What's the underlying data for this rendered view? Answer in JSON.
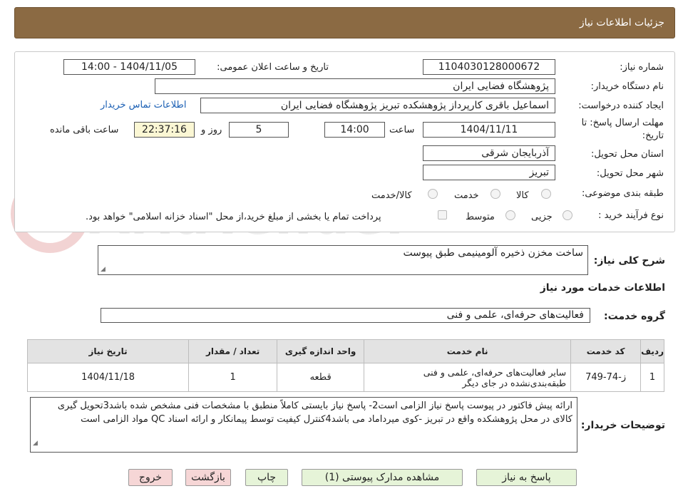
{
  "header": {
    "title": "جزئیات اطلاعات نیاز"
  },
  "watermark": {
    "text": "AriaTender.neT"
  },
  "fields": {
    "need_number_label": "شماره نیاز:",
    "need_number": "1104030128000672",
    "announce_label": "تاریخ و ساعت اعلان عمومی:",
    "announce_value": "1404/11/05 - 14:00",
    "buyer_label": "نام دستگاه خریدار:",
    "buyer_value": "پژوهشگاه فضایی ایران",
    "creator_label": "ایجاد کننده درخواست:",
    "creator_value": "اسماعیل باقری کارپرداز پژوهشکده تبریز پژوهشگاه فضایی ایران",
    "contact_link": "اطلاعات تماس خریدار",
    "deadline_label_1": "مهلت ارسال پاسخ: تا",
    "deadline_label_2": "تاریخ:",
    "deadline_date": "1404/11/11",
    "time_label": "ساعت",
    "deadline_time": "14:00",
    "days_value": "5",
    "days_label": "روز و",
    "remaining_time": "22:37:16",
    "remaining_label": "ساعت باقی مانده",
    "province_label": "استان محل تحویل:",
    "province_value": "آذربایجان شرقی",
    "city_label": "شهر محل تحویل:",
    "city_value": "تبریز",
    "category_label": "طبقه بندی موضوعی:",
    "category_options": [
      "کالا",
      "خدمت",
      "کالا/خدمت"
    ],
    "process_label": "نوع فرآیند خرید :",
    "process_options": [
      "جزیی",
      "متوسط"
    ],
    "payment_note": "پرداخت تمام یا بخشی از مبلغ خرید،از محل \"اسناد خزانه اسلامی\" خواهد بود."
  },
  "summary": {
    "label": "شرح کلی نیاز:",
    "value": "ساخت مخزن ذخیره آلومینیمی طبق پیوست"
  },
  "services": {
    "section_title": "اطلاعات خدمات مورد نیاز",
    "group_label": "گروه خدمت:",
    "group_value": "فعالیت‌های حرفه‌ای، علمی و فنی",
    "columns": [
      "ردیف",
      "کد خدمت",
      "نام خدمت",
      "واحد اندازه گیری",
      "تعداد / مقدار",
      "تاریخ نیاز"
    ],
    "rows": [
      {
        "row": "1",
        "code": "ز-74-749",
        "name": "سایر فعالیت‌های حرفه‌ای، علمی و فنی طبقه‌بندی‌نشده در جای دیگر",
        "unit": "قطعه",
        "qty": "1",
        "date": "1404/11/18"
      }
    ]
  },
  "buyer_notes": {
    "label": "توضیحات خریدار:",
    "value": "ارائه پیش فاکتور در پیوست پاسخ نیاز الزامی است2- پاسخ نیاز بایستی کاملاً منطبق با مشخصات فنی مشخص شده باشد3تحویل گیری کالای در محل پژوهشکده واقع در تبریز -کوی میرداماد می باشد4کنترل کیفیت توسط پیمانکار و ارائه اسناد QC مواد الزامی است"
  },
  "buttons": {
    "reply": "پاسخ به نیاز",
    "attachments": "مشاهده مدارک پیوستی (1)",
    "print": "چاپ",
    "back": "بازگشت",
    "exit": "خروج"
  },
  "colors": {
    "header_bg": "#8B6A43",
    "reply_bg": "#e6f4d8",
    "exit_bg": "#f6d6d6",
    "time_bg": "#fbf7d4",
    "link": "#1a5fb4"
  }
}
